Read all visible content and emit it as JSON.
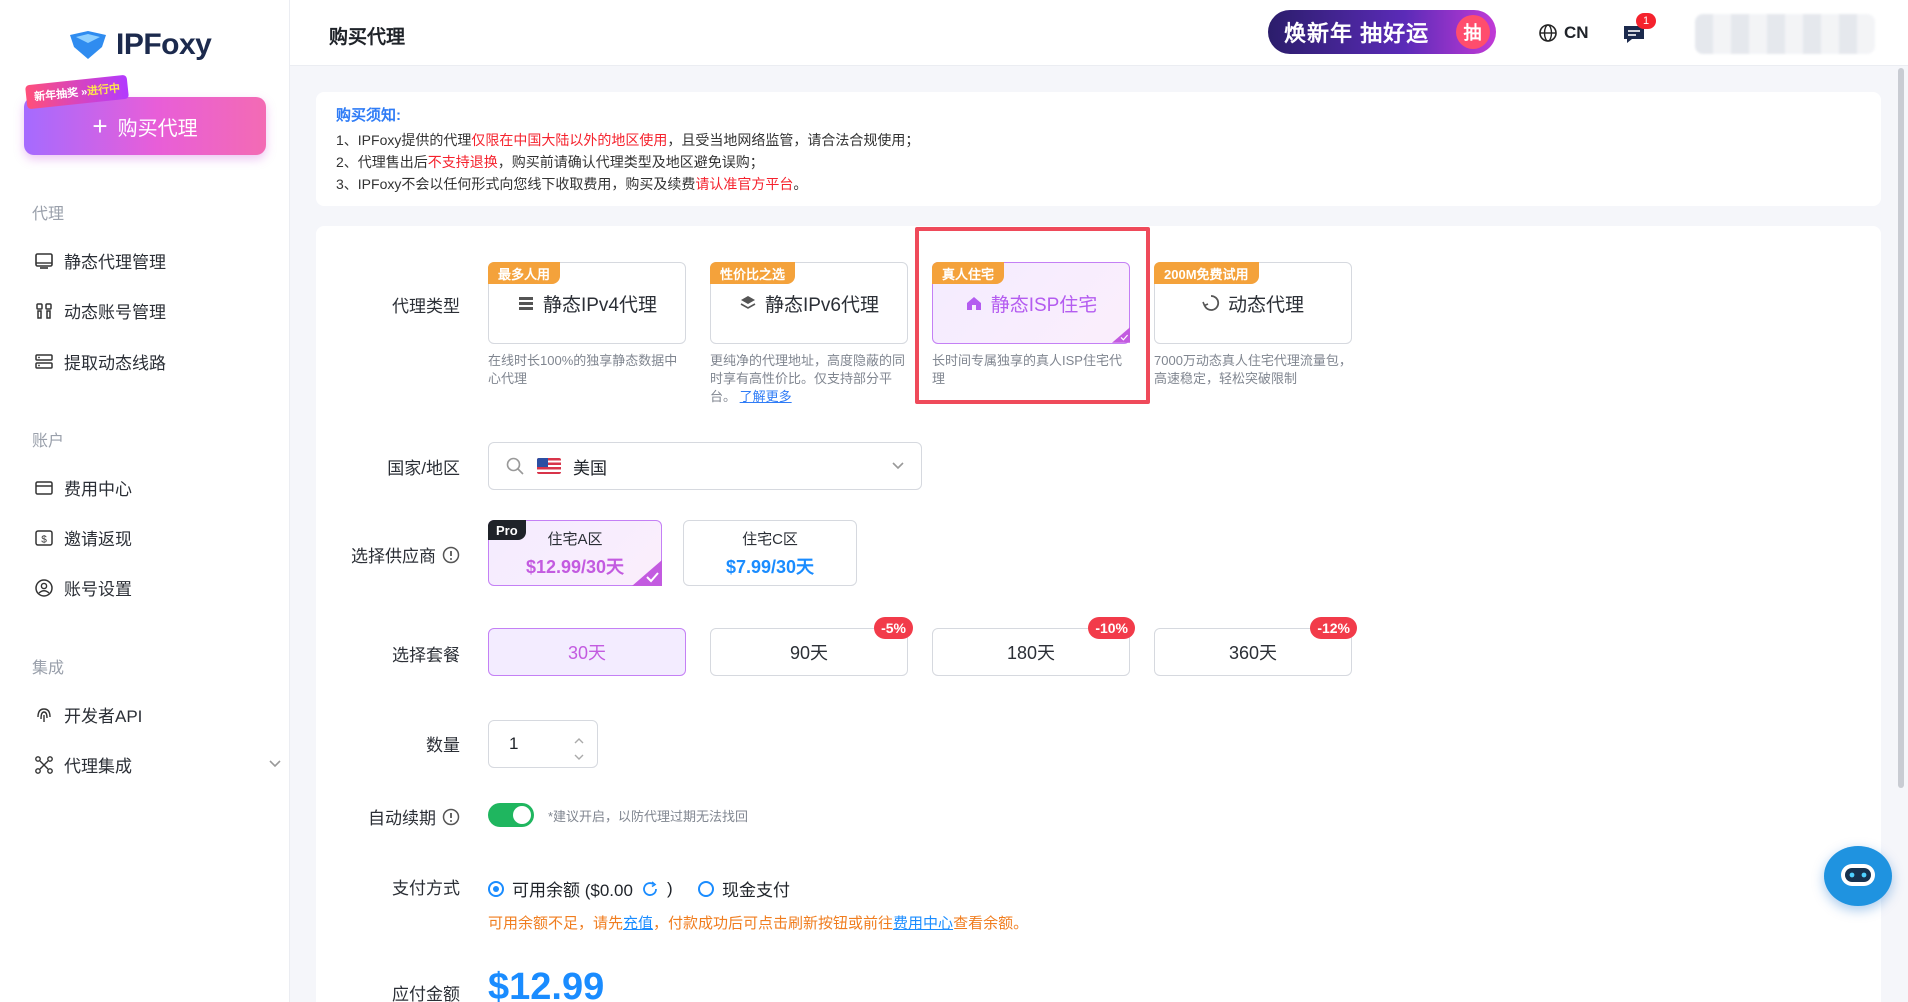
{
  "brand": {
    "name": "IPFoxy"
  },
  "sidebar": {
    "promo_tag": "新年抽奖 »",
    "promo_tag_hl": "进行中",
    "buy_button": "购买代理",
    "sections": [
      {
        "title": "代理",
        "items": [
          "静态代理管理",
          "动态账号管理",
          "提取动态线路"
        ]
      },
      {
        "title": "账户",
        "items": [
          "费用中心",
          "邀请返现",
          "账号设置"
        ]
      },
      {
        "title": "集成",
        "items": [
          "开发者API",
          "代理集成"
        ]
      }
    ]
  },
  "header": {
    "title": "购买代理",
    "promo_banner": "焕新年 抽好运",
    "promo_draw": "抽",
    "language": "CN",
    "msg_count": "1"
  },
  "notice": {
    "title": "购买须知:",
    "line1_a": "1、IPFoxy提供的代理",
    "line1_red": "仅限在中国大陆以外的地区使用",
    "line1_b": "，且受当地网络监管，请合法合规使用；",
    "line2_a": "2、代理售出后",
    "line2_red": "不支持退换",
    "line2_b": "，购买前请确认代理类型及地区避免误购；",
    "line3_a": "3、IPFoxy不会以任何形式向您线下收取费用，购买及续费",
    "line3_red": "请认准官方平台",
    "line3_b": "。"
  },
  "form": {
    "labels": {
      "type": "代理类型",
      "country": "国家/地区",
      "provider": "选择供应商",
      "plan": "选择套餐",
      "qty": "数量",
      "renew": "自动续期",
      "payment": "支付方式",
      "total": "应付金额"
    },
    "types": [
      {
        "tag": "最多人用",
        "label": "静态IPv4代理",
        "desc": "在线时长100%的独享静态数据中心代理"
      },
      {
        "tag": "性价比之选",
        "label": "静态IPv6代理",
        "desc": "更纯净的代理地址，高度隐蔽的同时享有高性价比。仅支持部分平台。",
        "link": "了解更多"
      },
      {
        "tag": "真人住宅",
        "label": "静态ISP住宅",
        "desc": "长时间专属独享的真人ISP住宅代理"
      },
      {
        "tag": "200M免费试用",
        "label": "动态代理",
        "desc": "7000万动态真人住宅代理流量包，高速稳定，轻松突破限制"
      }
    ],
    "country": "美国",
    "providers": [
      {
        "tag": "Pro",
        "name": "住宅A区",
        "price": "$12.99/30天"
      },
      {
        "name": "住宅C区",
        "price": "$7.99/30天"
      }
    ],
    "plans": [
      {
        "label": "30天"
      },
      {
        "label": "90天",
        "discount": "-5%"
      },
      {
        "label": "180天",
        "discount": "-10%"
      },
      {
        "label": "360天",
        "discount": "-12%"
      }
    ],
    "qty": "1",
    "renew_hint": "*建议开启，以防代理过期无法找回",
    "payment": {
      "balance": "可用余额 ($0.00",
      "balance_close": ")",
      "cash": "现金支付",
      "warn_a": "可用余额不足，请先",
      "warn_link1": "充值",
      "warn_b": "，付款成功后可点击刷新按钮或前往",
      "warn_link2": "费用中心",
      "warn_c": "查看余额。"
    },
    "total": "$12.99"
  }
}
